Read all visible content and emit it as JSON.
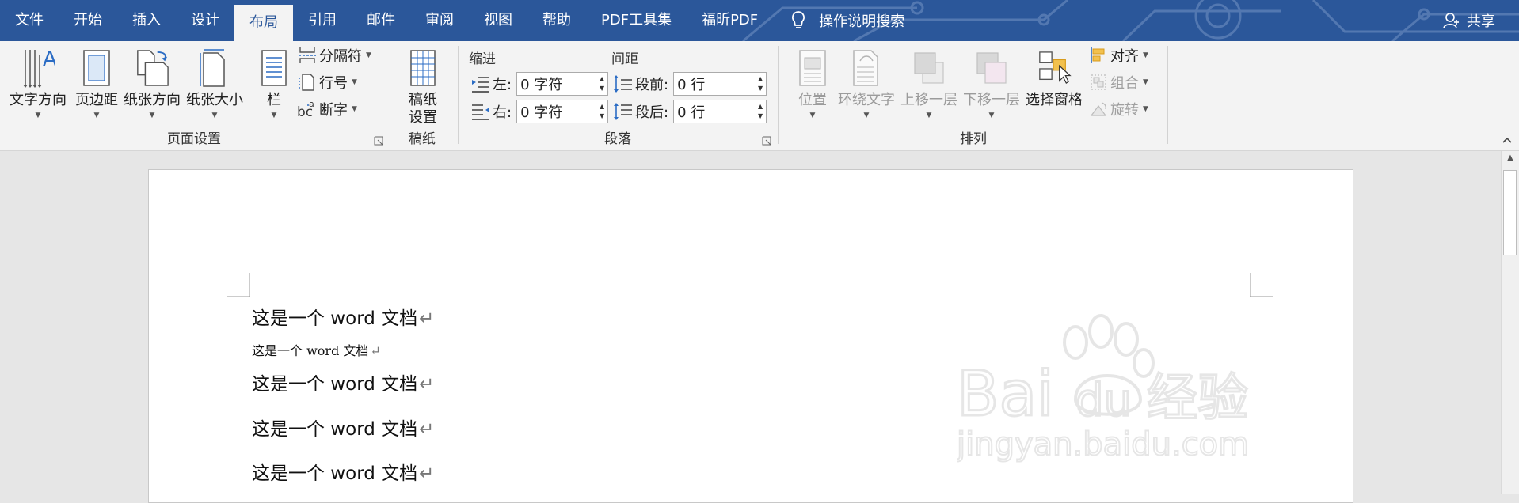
{
  "tabs": [
    {
      "label": "文件",
      "active": false
    },
    {
      "label": "开始",
      "active": false
    },
    {
      "label": "插入",
      "active": false
    },
    {
      "label": "设计",
      "active": false
    },
    {
      "label": "布局",
      "active": true
    },
    {
      "label": "引用",
      "active": false
    },
    {
      "label": "邮件",
      "active": false
    },
    {
      "label": "审阅",
      "active": false
    },
    {
      "label": "视图",
      "active": false
    },
    {
      "label": "帮助",
      "active": false
    },
    {
      "label": "PDF工具集",
      "active": false
    },
    {
      "label": "福昕PDF",
      "active": false
    }
  ],
  "tell_me": "操作说明搜索",
  "share": "共享",
  "ribbon": {
    "page_setup": {
      "label": "页面设置",
      "text_direction": "文字方向",
      "margins": "页边距",
      "orientation": "纸张方向",
      "size": "纸张大小",
      "columns": "栏",
      "breaks": "分隔符",
      "line_numbers": "行号",
      "hyphenation": "断字"
    },
    "manuscript": {
      "label": "稿纸",
      "setup": "稿纸\n设置"
    },
    "paragraph": {
      "label": "段落",
      "indent_title": "缩进",
      "spacing_title": "间距",
      "left_label": "左:",
      "left_value": "0 字符",
      "right_label": "右:",
      "right_value": "0 字符",
      "before_label": "段前:",
      "before_value": "0 行",
      "after_label": "段后:",
      "after_value": "0 行"
    },
    "arrange": {
      "label": "排列",
      "position": "位置",
      "wrap_text": "环绕文字",
      "bring_forward": "上移一层",
      "send_backward": "下移一层",
      "selection_pane": "选择窗格",
      "align": "对齐",
      "group": "组合",
      "rotate": "旋转"
    }
  },
  "document": {
    "lines": [
      "这是一个 word 文档",
      "这是一个 word 文档",
      "这是一个 word 文档",
      "这是一个 word 文档",
      "这是一个 word 文档"
    ],
    "paragraph_mark": "↵"
  },
  "colors": {
    "title_bar": "#2b579a",
    "ribbon": "#f3f3f3",
    "canvas": "#e6e6e6"
  }
}
